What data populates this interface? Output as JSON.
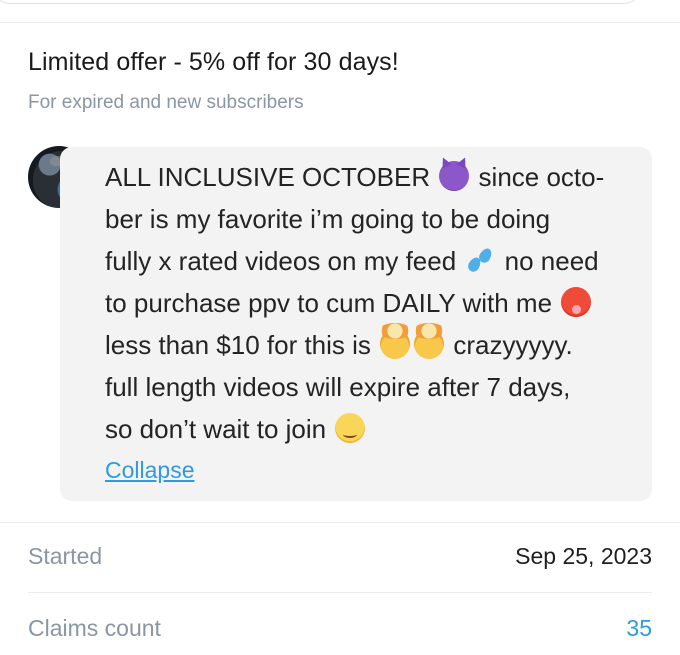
{
  "offer": {
    "title": "Limited offer - 5% off for 30 days!",
    "subtitle": "For expired and new subscribers"
  },
  "message": {
    "lines": [
      [
        "ALL INCLUSIVE OCTOBER ",
        "devil-emoji",
        " since octo-"
      ],
      [
        "ber is my favorite i’m going to be doing"
      ],
      [
        "fully x rated videos on my feed ",
        "sweat-droplets-emoji",
        " no need"
      ],
      [
        "to purchase ppv to cum DAILY with me ",
        "hot-face-emoji"
      ],
      [
        "less than $10 for this is ",
        "exploding-head-emoji",
        "exploding-head-emoji",
        " crazyyyyy."
      ],
      [
        "full length videos will expire after 7 days,"
      ],
      [
        "so don’t wait to join ",
        "winking-face-emoji"
      ]
    ],
    "collapse_label": "Collapse"
  },
  "stats": {
    "started_label": "Started",
    "started_value": "Sep 25, 2023",
    "claims_label": "Claims count",
    "claims_value": "35"
  },
  "colors": {
    "accent": "#2f9ae0",
    "muted": "#8a96a3",
    "bubble": "#f3f3f4"
  }
}
